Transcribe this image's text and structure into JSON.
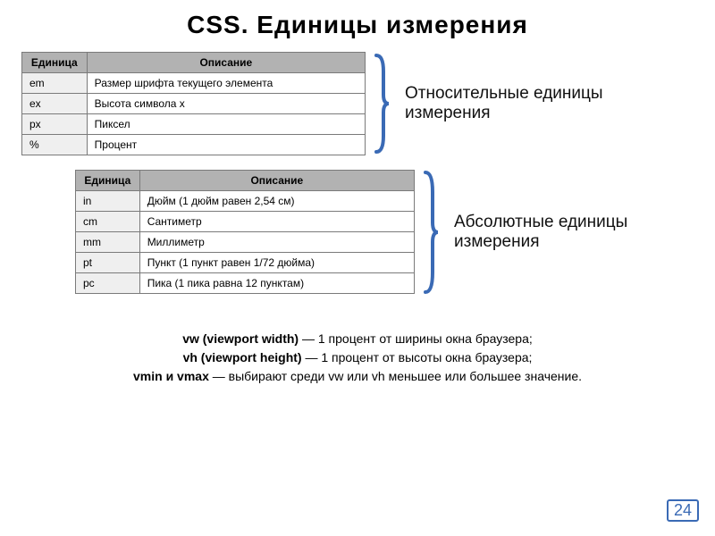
{
  "title": "CSS. Единицы измерения",
  "table1": {
    "headers": {
      "unit": "Единица",
      "desc": "Описание"
    },
    "rows": [
      {
        "unit": "em",
        "desc": "Размер шрифта текущего элемента"
      },
      {
        "unit": "ex",
        "desc": "Высота символа x"
      },
      {
        "unit": "px",
        "desc": "Пиксел"
      },
      {
        "unit": "%",
        "desc": "Процент"
      }
    ],
    "caption": "Относительные единицы измерения"
  },
  "table2": {
    "headers": {
      "unit": "Единица",
      "desc": "Описание"
    },
    "rows": [
      {
        "unit": "in",
        "desc": "Дюйм (1 дюйм равен 2,54 см)"
      },
      {
        "unit": "cm",
        "desc": "Сантиметр"
      },
      {
        "unit": "mm",
        "desc": "Миллиметр"
      },
      {
        "unit": "pt",
        "desc": "Пункт (1 пункт равен 1/72 дюйма)"
      },
      {
        "unit": "pc",
        "desc": "Пика (1 пика равна 12 пунктам)"
      }
    ],
    "caption": "Абсолютные единицы измерения"
  },
  "footer": {
    "line1_bold": "vw (viewport width)",
    "line1_rest": " — 1 процент от ширины окна браузера;",
    "line2_bold": "vh (viewport height)",
    "line2_rest": " — 1 процент от высоты окна браузера;",
    "line3_bold": "vmin и vmax",
    "line3_rest": " — выбирают среди vw или vh меньшее или большее значение."
  },
  "page_number": "24"
}
